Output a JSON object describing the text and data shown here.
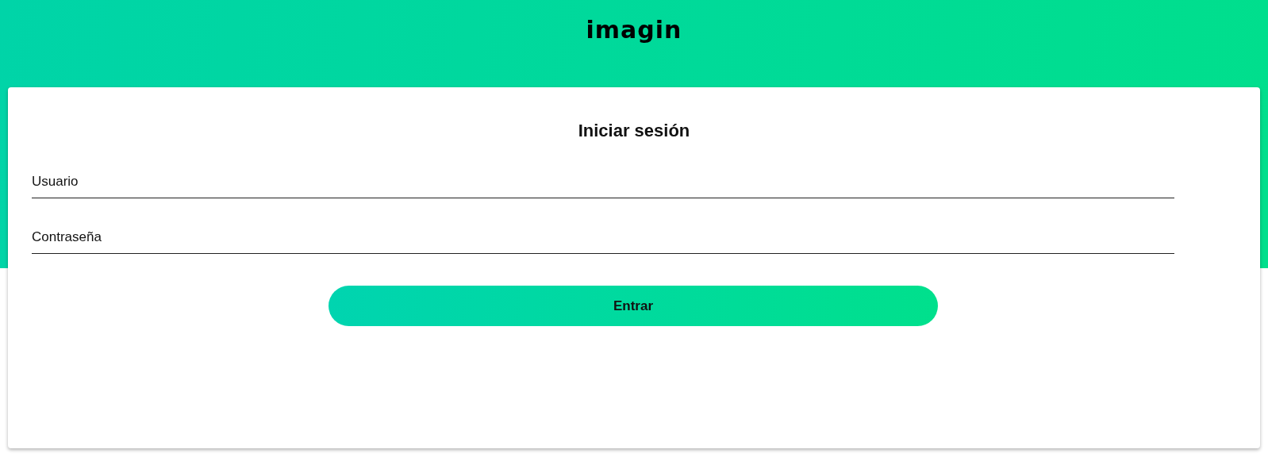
{
  "header": {
    "logo": "imagin"
  },
  "form": {
    "title": "Iniciar sesión",
    "fields": [
      {
        "placeholder": "Usuario"
      },
      {
        "placeholder": "Contraseña"
      }
    ],
    "submit": "Entrar"
  }
}
